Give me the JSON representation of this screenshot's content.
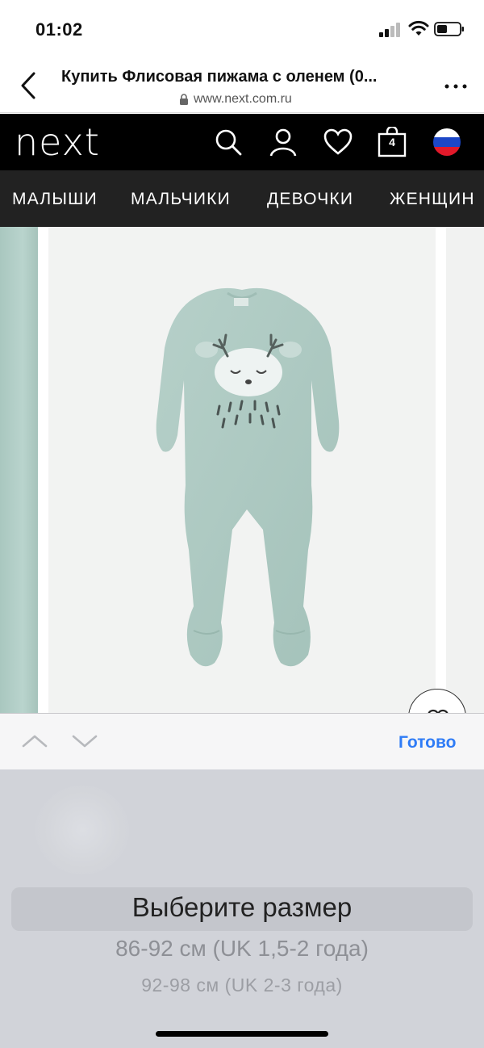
{
  "status_bar": {
    "time": "01:02"
  },
  "browser": {
    "title": "Купить Флисовая пижама с оленем (0...",
    "url": "www.next.com.ru"
  },
  "header": {
    "logo": "next",
    "bag_count": "4"
  },
  "nav": {
    "categories": [
      "МАЛЫШИ",
      "МАЛЬЧИКИ",
      "ДЕВОЧКИ",
      "ЖЕНЩИН"
    ]
  },
  "accessory_bar": {
    "done_label": "Готово"
  },
  "picker": {
    "options": [
      "Выберите размер",
      "86-92 см (UK 1,5-2 года)",
      "92-98 см (UK 2-3 года)"
    ]
  },
  "colors": {
    "header_bg": "#000000",
    "nav_bg": "#222222",
    "link_blue": "#2f7cf6",
    "picker_bg": "#d1d3d9",
    "product_mint": "#a9c7bf"
  }
}
